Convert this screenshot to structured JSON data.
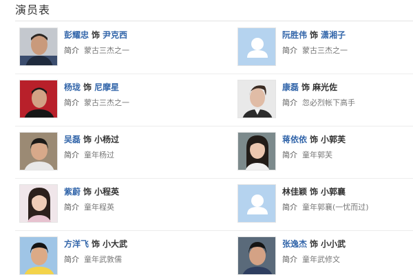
{
  "section_title": "演员表",
  "as_word": "饰",
  "intro_label": "简介",
  "cast": [
    {
      "actor": "彭耀忠",
      "role": "尹克西",
      "intro": "蒙古三杰之一",
      "photo": "actor-photo",
      "role_link": true
    },
    {
      "actor": "阮胜伟",
      "role": "潇湘子",
      "intro": "蒙古三杰之一",
      "photo": "placeholder-avatar",
      "role_link": true
    },
    {
      "actor": "杨珑",
      "role": "尼摩星",
      "intro": "蒙古三杰之一",
      "photo": "actor-photo",
      "role_link": true
    },
    {
      "actor": "康磊",
      "role": "麻光佐",
      "intro": "忽必烈帐下高手",
      "photo": "actor-photo",
      "role_link": false
    },
    {
      "actor": "吴磊",
      "role": "小杨过",
      "intro": "童年杨过",
      "photo": "actor-photo",
      "role_link": false
    },
    {
      "actor": "蒋依依",
      "role": "小郭芙",
      "intro": "童年郭芙",
      "photo": "actor-photo",
      "role_link": false
    },
    {
      "actor": "紫蔚",
      "role": "小程英",
      "intro": "童年程英",
      "photo": "actor-photo",
      "role_link": false
    },
    {
      "actor": "林佳颖",
      "role": "小郭襄",
      "intro": "童年郭襄(一忧而过)",
      "photo": "placeholder-avatar",
      "role_link": false,
      "actor_plain": true
    },
    {
      "actor": "方洋飞",
      "role": "小大武",
      "intro": "童年武敦儒",
      "photo": "actor-photo",
      "role_link": false
    },
    {
      "actor": "张逸杰",
      "role": "小小武",
      "intro": "童年武修文",
      "photo": "actor-photo",
      "role_link": false
    }
  ],
  "colors": {
    "link": "#3366aa",
    "text": "#333333",
    "muted": "#777777",
    "placeholder_bg": "#b5d3ef",
    "placeholder_fg": "#ffffff"
  }
}
